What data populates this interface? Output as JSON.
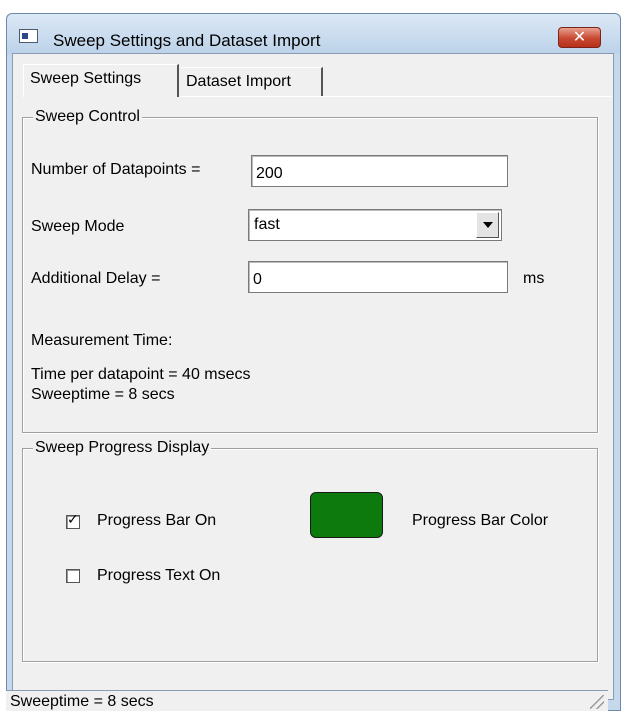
{
  "window": {
    "title": "Sweep Settings and Dataset Import",
    "close_glyph": "✕"
  },
  "tabs": [
    {
      "label": "Sweep Settings",
      "active": true
    },
    {
      "label": "Dataset Import",
      "active": false
    }
  ],
  "sweep_control": {
    "title": "Sweep Control",
    "datapoints_label": "Number of Datapoints =",
    "datapoints_value": "200",
    "sweep_mode_label": "Sweep Mode",
    "sweep_mode_value": "fast",
    "delay_label": "Additional Delay =",
    "delay_value": "0",
    "delay_unit": "ms",
    "measurement_time_label": "Measurement Time:",
    "time_per_datapoint": "Time per datapoint = 40 msecs",
    "sweeptime": "Sweeptime = 8 secs"
  },
  "progress_display": {
    "title": "Sweep Progress Display",
    "progress_bar_on_label": "Progress Bar On",
    "progress_bar_on_checked": true,
    "progress_text_on_label": "Progress Text On",
    "progress_text_on_checked": false,
    "progress_bar_color_label": "Progress Bar Color",
    "progress_bar_color": "#0c7a0c"
  },
  "statusbar": {
    "text": "Sweeptime = 8 secs"
  },
  "icons": [
    "app-window-icon",
    "close-icon",
    "chevron-down-icon",
    "checkmark-icon",
    "resize-grip-icon"
  ]
}
